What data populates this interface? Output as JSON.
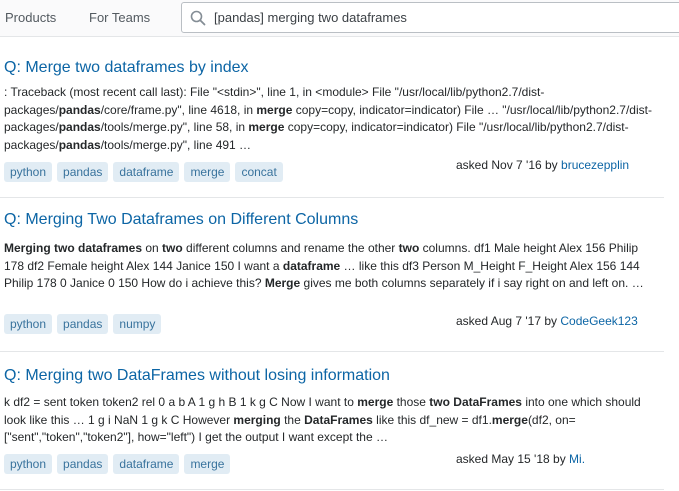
{
  "nav": {
    "products": "Products",
    "teams": "For Teams"
  },
  "search": {
    "value": "[pandas] merging two dataframes",
    "icon": "search-icon"
  },
  "results": [
    {
      "title": "Q: Merge two dataframes by index",
      "excerpt_html": ": Traceback (most recent call last): File \"&lt;stdin&gt;\", line 1, in &lt;module&gt; File \"/usr/local/lib/python2.7/dist-packages/<b>pandas</b>/core/frame.py\", line 4618, in <b>merge</b> copy=copy, indicator=indicator) File … \"/usr/local/lib/python2.7/dist-packages/<b>pandas</b>/tools/merge.py\", line 58, in <b>merge</b> copy=copy, indicator=indicator) File \"/usr/local/lib/python2.7/dist-packages/<b>pandas</b>/tools/merge.py\", line 491 …",
      "tags": [
        "python",
        "pandas",
        "dataframe",
        "merge",
        "concat"
      ],
      "asked": "asked Nov 7 '16 by",
      "user": "brucezepplin"
    },
    {
      "title": "Q: Merging Two Dataframes on Different Columns",
      "excerpt_html": "<b>Merging two dataframes</b> on <b>two</b> different columns and rename the other <b>two</b> columns. df1 Male height Alex 156 Philip 178 df2 Female height Alex 144 Janice 150 I want a <b>dataframe</b> … like this df3 Person M_Height F_Height Alex 156 144 Philip 178 0 Janice 0 150 How do i achieve this? <b>Merge</b> gives me both columns separately if i say right on and left on. …",
      "tags": [
        "python",
        "pandas",
        "numpy"
      ],
      "asked": "asked Aug 7 '17 by",
      "user": "CodeGeek123"
    },
    {
      "title": "Q: Merging two DataFrames without losing information",
      "excerpt_html": "k df2 = sent token token2 rel 0 a b A 1 g h B 1 k g C Now I want to <b>merge</b> those <b>two DataFrames</b> into one which should look like this … 1 g i NaN 1 g k C However <b>merging</b> the <b>DataFrames</b> like this df_new = df1.<b>merge</b>(df2, on=[\"sent\",\"token\",\"token2\"], how=\"left\") I get the output I want except the …",
      "tags": [
        "python",
        "pandas",
        "dataframe",
        "merge"
      ],
      "asked": "asked May 15 '18 by",
      "user": "Mi."
    }
  ]
}
